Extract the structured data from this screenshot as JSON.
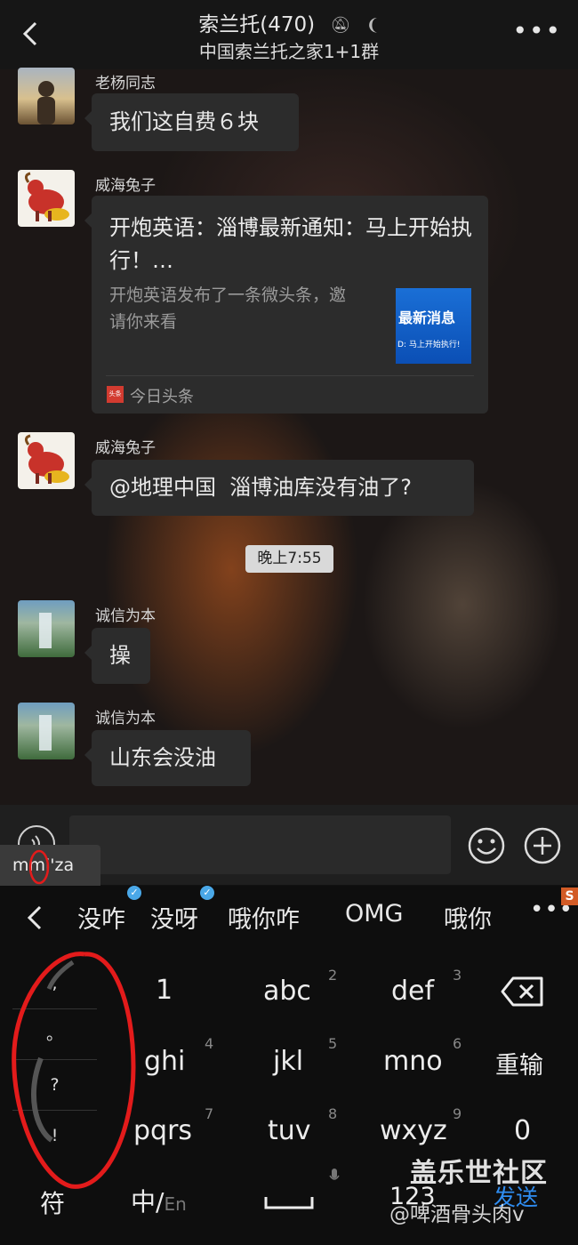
{
  "header": {
    "group_title": "索兰托(470)",
    "group_subtitle": "中国索兰托之家1+1群"
  },
  "messages": [
    {
      "sender": "老杨同志",
      "text": "我们这自费６块"
    },
    {
      "sender": "威海兔子",
      "card": {
        "title": "开炮英语：淄博最新通知：马上开始执行！…",
        "desc": "开炮英语发布了一条微头条，邀请你来看",
        "thumb_title": "最新消息",
        "thumb_caption": "D: 马上开始执行!",
        "thumb_badge": "头条",
        "source": "今日头条"
      }
    },
    {
      "sender": "威海兔子",
      "text": "@地理中国  淄博油库没有油了?"
    },
    {
      "sender": "诚信为本",
      "text": "操"
    },
    {
      "sender": "诚信为本",
      "text": "山东会没油"
    }
  ],
  "time_divider": "晚上7:55",
  "input": {
    "composing_text": "mmi'za"
  },
  "keyboard": {
    "candidates": [
      "没咋",
      "没呀",
      "哦你咋",
      "OMG",
      "哦你"
    ],
    "symbols": [
      ",",
      "。",
      "?",
      "!"
    ],
    "keys": {
      "k1": "1",
      "abc": "abc",
      "def": "def",
      "ghi": "ghi",
      "jkl": "jkl",
      "mno": "mno",
      "retype": "重输",
      "pqrs": "pqrs",
      "tuv": "tuv",
      "wxyz": "wxyz",
      "zero": "0",
      "symbol": "符",
      "zh": "中/",
      "en": "En",
      "num": "123",
      "send": "发送"
    },
    "key_numbers": [
      "2",
      "3",
      "4",
      "5",
      "6",
      "7",
      "8",
      "9"
    ]
  },
  "watermark": {
    "line1": "盖乐世社区",
    "line2": "@啤酒骨头肉v"
  },
  "colors": {
    "accent_blue": "#2f8df1",
    "bubble_bg": "#2c2c2c",
    "annotation_red": "#e31b1b"
  }
}
